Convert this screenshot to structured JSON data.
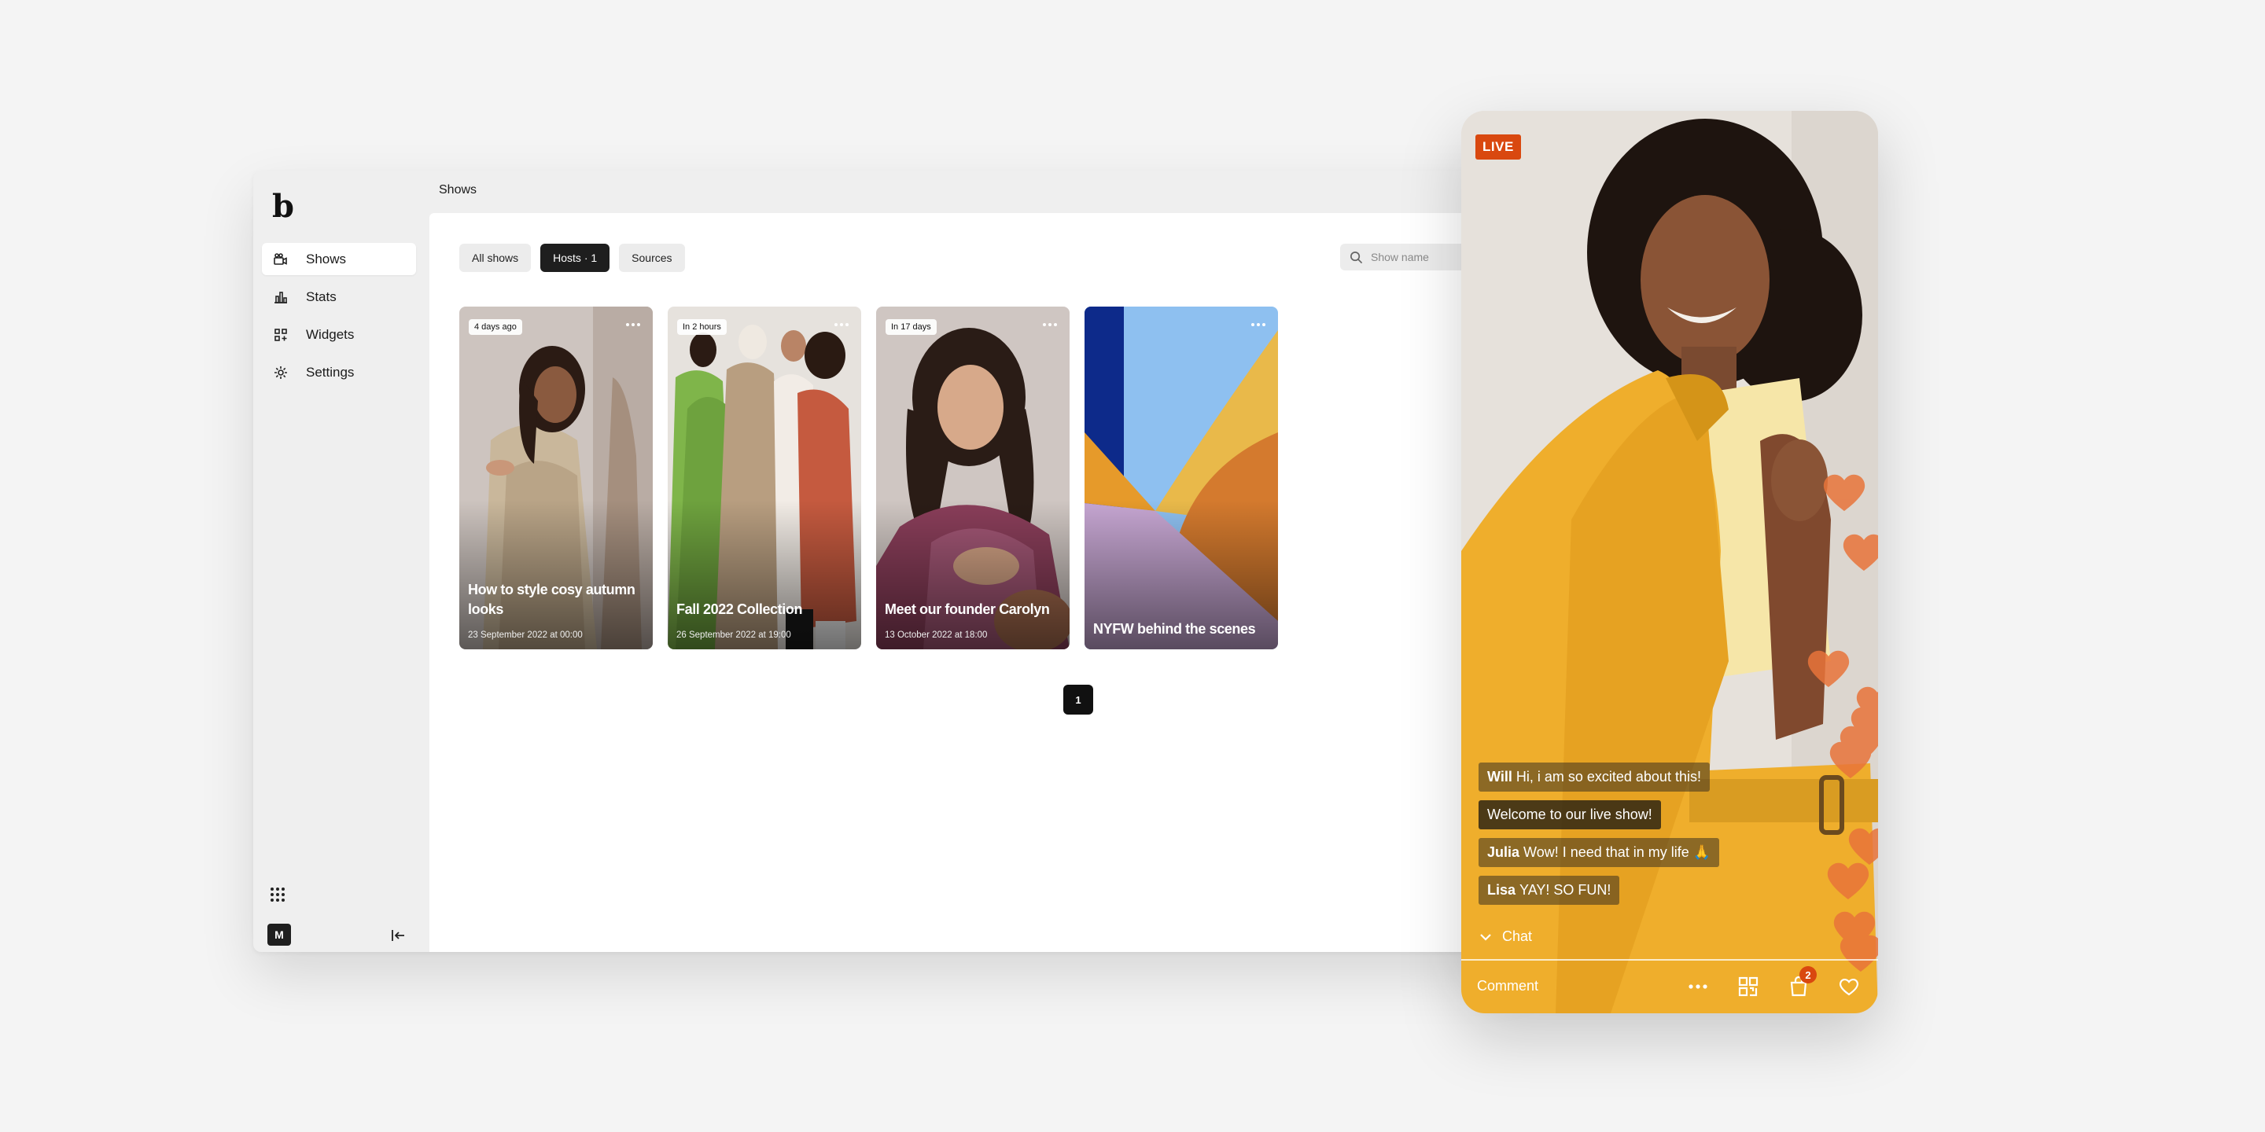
{
  "sidebar": {
    "logo": "b",
    "items": [
      {
        "label": "Shows",
        "icon": "video-camera-icon",
        "active": true
      },
      {
        "label": "Stats",
        "icon": "bar-chart-icon",
        "active": false
      },
      {
        "label": "Widgets",
        "icon": "widgets-icon",
        "active": false
      },
      {
        "label": "Settings",
        "icon": "gear-icon",
        "active": false
      }
    ],
    "user_initial": "M"
  },
  "header": {
    "title": "Shows"
  },
  "filters": {
    "chips": [
      "All shows",
      "Hosts · 1",
      "Sources"
    ],
    "active_index": 1
  },
  "search": {
    "placeholder": "Show name"
  },
  "shows": [
    {
      "badge": "4 days ago",
      "title": "How to style cosy autumn looks",
      "date": "23 September 2022 at 00:00"
    },
    {
      "badge": "In 2 hours",
      "title": "Fall 2022 Collection",
      "date": "26 September 2022 at 19:00"
    },
    {
      "badge": "In 17 days",
      "title": "Meet our founder Carolyn",
      "date": "13 October 2022 at 18:00"
    },
    {
      "badge": "",
      "title": "NYFW behind the scenes",
      "date": ""
    }
  ],
  "pagination": {
    "current": "1"
  },
  "live": {
    "badge": "LIVE",
    "messages": [
      {
        "user": "Will",
        "text": "Hi, i am so excited about this!"
      },
      {
        "user": "",
        "text": "Welcome to our live show!"
      },
      {
        "user": "Julia",
        "text": "Wow! I need that in my life 🙏"
      },
      {
        "user": "Lisa",
        "text": "YAY! SO FUN!"
      }
    ],
    "chat_label": "Chat",
    "comment_placeholder": "Comment",
    "cart_count": "2"
  },
  "colors": {
    "accent": "#d9480f",
    "active_chip": "#1e1e1e",
    "heart": "#e8743a"
  }
}
